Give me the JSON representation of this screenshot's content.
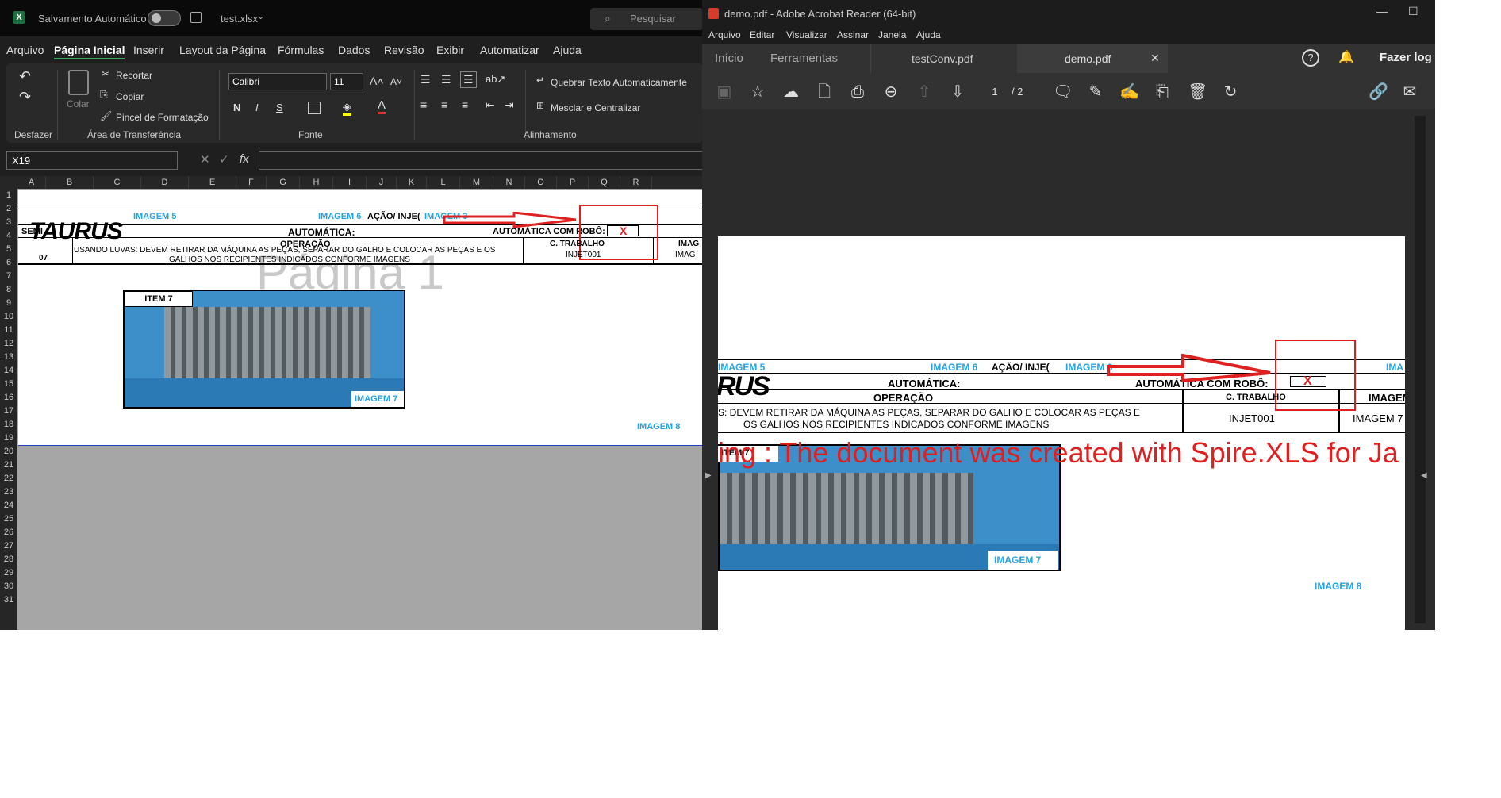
{
  "excel": {
    "autosave_label": "Salvamento Automático",
    "filename": "test.xlsx",
    "search_placeholder": "Pesquisar",
    "menu": [
      "Arquivo",
      "Página Inicial",
      "Inserir",
      "Layout da Página",
      "Fórmulas",
      "Dados",
      "Revisão",
      "Exibir",
      "Automatizar",
      "Ajuda"
    ],
    "ribbon": {
      "recortar": "Recortar",
      "colar": "Colar",
      "copiar": "Copiar",
      "pincel": "Pincel de Formatação",
      "font_name": "Calibri",
      "font_size": "11",
      "bold": "N",
      "italic": "I",
      "underline": "S",
      "wrap": "Quebrar Texto Automaticamente",
      "merge": "Mesclar e Centralizar",
      "group_undo": "Desfazer",
      "group_clip": "Área de Transferência",
      "group_font": "Fonte",
      "group_align": "Alinhamento"
    },
    "name_box": "X19",
    "columns": [
      "A",
      "B",
      "C",
      "D",
      "E",
      "F",
      "G",
      "H",
      "I",
      "J",
      "K",
      "L",
      "M",
      "N",
      "O",
      "P",
      "Q",
      "R"
    ],
    "rows": [
      "1",
      "2",
      "3",
      "4",
      "5",
      "6",
      "7",
      "8",
      "9",
      "10",
      "11",
      "12",
      "13",
      "14",
      "15",
      "16",
      "17",
      "18",
      "19",
      "20",
      "21",
      "22",
      "23",
      "24",
      "25",
      "26",
      "27",
      "28",
      "29",
      "30",
      "31"
    ],
    "sheet": {
      "imagem5": "IMAGEM 5",
      "imagem6": "IMAGEM 6",
      "acao": "AÇÃO/ INJE(",
      "imagem3": "IMAGEM 3",
      "semi": "SEMI",
      "automatica": "AUTOMÁTICA:",
      "com_robo": "AUTOMÁTICA COM ROBÔ:",
      "x_mark": "X",
      "operacao": "OPERAÇÃO",
      "c_trabalho": "C. TRABALHO",
      "imag": "IMAG",
      "num07": "07",
      "instr_1": "USANDO LUVAS: DEVEM RETIRAR DA MÁQUINA AS PEÇAS, SEPARAR DO GALHO E COLOCAR AS PEÇAS E OS",
      "instr_2": "GALHOS NOS RECIPIENTES INDICADOS CONFORME IMAGENS",
      "injet": "INJET001",
      "item7": "ITEM 7",
      "imagem7": "IMAGEM 7",
      "imagem8": "IMAGEM 8",
      "pagina_watermark": "Página 1",
      "logo": "TAURUS"
    }
  },
  "acrobat": {
    "title": "demo.pdf - Adobe Acrobat Reader (64-bit)",
    "menu": [
      "Arquivo",
      "Editar",
      "Visualizar",
      "Assinar",
      "Janela",
      "Ajuda"
    ],
    "tabs": [
      "Início",
      "Ferramentas",
      "testConv.pdf",
      "demo.pdf"
    ],
    "login": "Fazer log",
    "page_current": "1",
    "page_total": "/ 2",
    "pdf": {
      "imagem5": "IMAGEM  5",
      "imagem6": "IMAGEM  6",
      "acao": "AÇÃO/ INJE(",
      "imagem3": "IMAGEM  3",
      "ima": "IMA",
      "automatica": "AUTOMÁTICA:",
      "com_robo": "AUTOMÁTICA COM ROBÔ:",
      "x_mark": "X",
      "operacao": "OPERAÇÃO",
      "c_trabalho": "C. TRABALHO",
      "imagem_hdr": "IMAGEM",
      "instr_1": "S: DEVEM RETIRAR DA MÁQUINA AS PEÇAS, SEPARAR DO GALHO E COLOCAR AS PEÇAS E",
      "instr_2": "OS GALHOS NOS RECIPIENTES INDICADOS CONFORME IMAGENS",
      "injet": "INJET001",
      "imagem7_cell": "IMAGEM 7",
      "watermark": "ing : The document was created with  Spire.XLS for Ja",
      "item7": "ITEM 7",
      "imagem7": "IMAGEM  7",
      "imagem8": "IMAGEM  8",
      "logo": "RUS"
    }
  }
}
